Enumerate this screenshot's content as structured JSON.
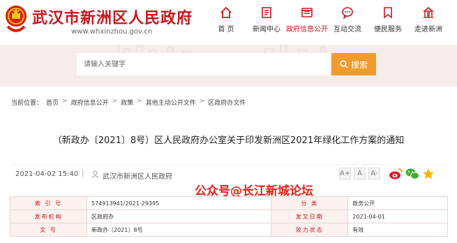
{
  "header": {
    "site_name": "武汉市新洲区人民政府",
    "site_url": "www.whxinzhou.gov.cn"
  },
  "nav": [
    {
      "label": "首 页",
      "icon": "home-icon"
    },
    {
      "label": "新闻中心",
      "icon": "news-icon"
    },
    {
      "label": "政府信息公开",
      "icon": "info-open-icon",
      "active": true
    },
    {
      "label": "互动交流",
      "icon": "chat-icon"
    },
    {
      "label": "便民服务",
      "icon": "service-icon"
    },
    {
      "label": "走进新洲",
      "icon": "landmark-icon"
    }
  ],
  "search": {
    "placeholder": "请输入关键字",
    "button_label": "搜索"
  },
  "breadcrumb": {
    "prefix": "当前位置：",
    "items": [
      "首页",
      "政府信息公开",
      "政策",
      "其他主动公开文件",
      "区政府办文件"
    ]
  },
  "article": {
    "title": "（新政办〔2021〕8号）区人民政府办公室关于印发新洲区2021年绿化工作方案的通知",
    "date": "2021-04-02 15:40",
    "separator": "|",
    "source": "武汉市新洲区人民政府"
  },
  "font_sizes": [
    "A+",
    "A",
    "A-"
  ],
  "share": [
    "weibo-icon",
    "wechat-icon",
    "favorite-icon"
  ],
  "watermark": "公众号@长江新城论坛",
  "info_table": [
    {
      "k1": "索 引 号",
      "v1": "574913941/2021-29395",
      "k2": "分 类",
      "v2": "政务公开"
    },
    {
      "k1": "发布机构",
      "v1": "区政府办",
      "k2": "发文日期",
      "v2": "2021-04-01"
    },
    {
      "k1": "文 号",
      "v1": "新政办〔2021〕8号",
      "k2": "效力状态",
      "v2": "有效"
    }
  ],
  "colors": {
    "brand": "#c8161d",
    "accent": "#f19b2c",
    "band": "#f6ece9"
  }
}
